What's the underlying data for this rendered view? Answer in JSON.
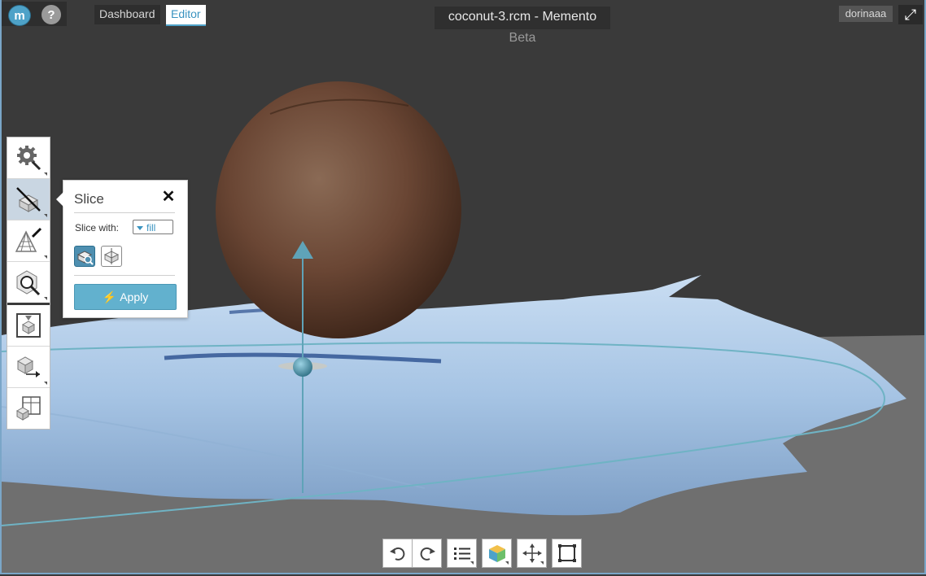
{
  "app": {
    "logo_glyph": "m",
    "help_glyph": "?",
    "nav": {
      "dashboard": "Dashboard",
      "editor": "Editor"
    },
    "document_title": "coconut-3.rcm - Memento",
    "beta_label": "Beta",
    "user": "dorinaaa",
    "expand_glyph": "⤢"
  },
  "toolbar": {
    "icons": [
      "settings-gear-icon",
      "slice-tool-icon",
      "mesh-paint-icon",
      "inspect-mesh-icon",
      "import-model-icon",
      "export-model-icon",
      "layout-icon"
    ]
  },
  "slice_panel": {
    "title": "Slice",
    "close_glyph": "✕",
    "slice_with_label": "Slice with:",
    "slice_with_value": "fill",
    "apply_label": "Apply",
    "apply_icon": "⚡"
  },
  "bottom_toolbar": {
    "icons": [
      "undo-icon",
      "redo-icon",
      "list-icon",
      "color-cube-icon",
      "move-axes-icon",
      "frame-selection-icon"
    ]
  },
  "colors": {
    "accent": "#4ea2c8",
    "viewport_bg": "#3a3a3a",
    "mesh": "#a9c8e8",
    "coconut": "#6b4a36",
    "gizmo": "#5fa3b8"
  }
}
